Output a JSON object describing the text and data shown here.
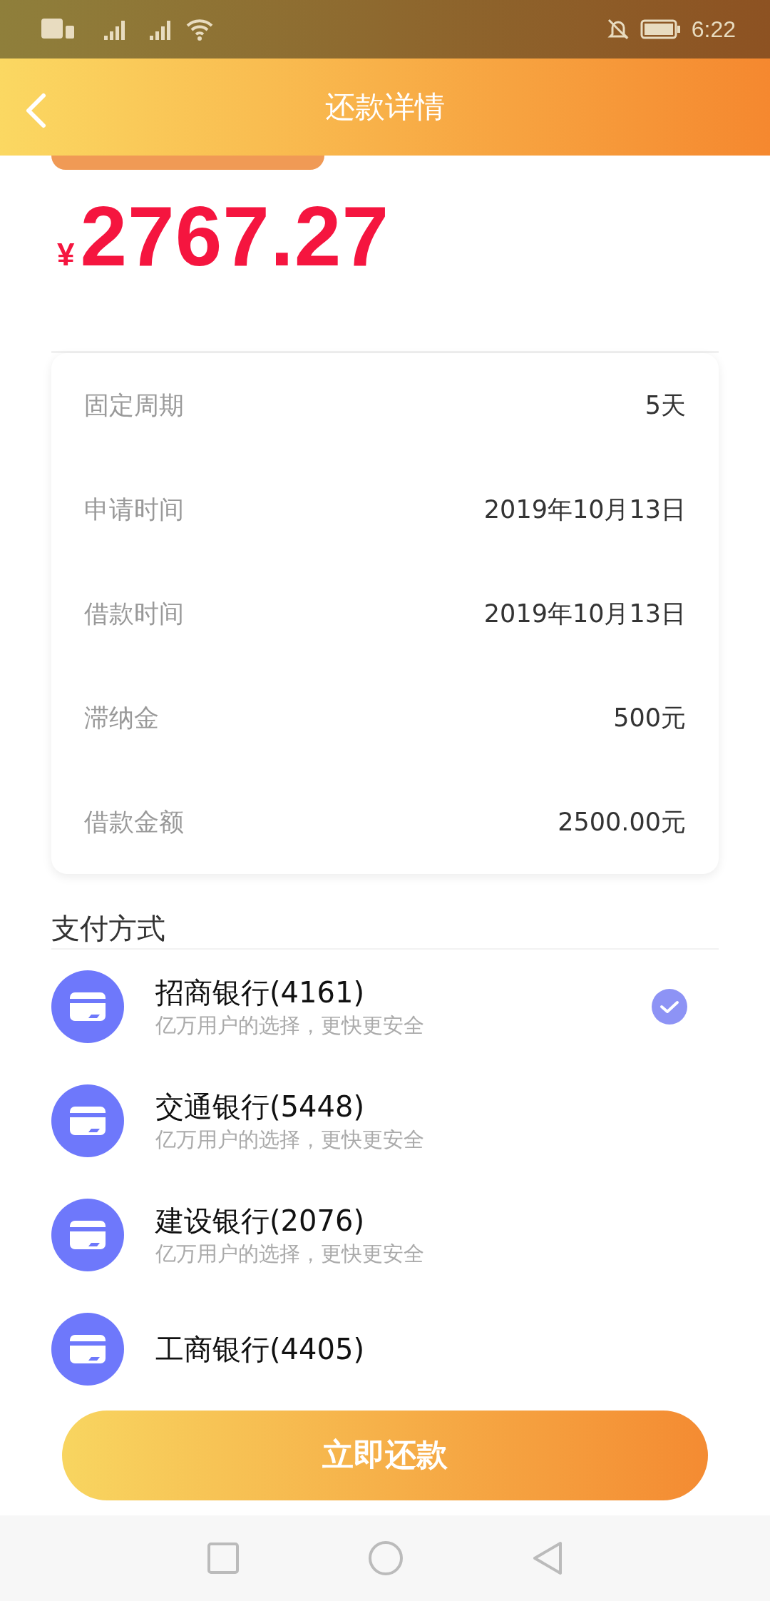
{
  "status_bar": {
    "time": "6:22"
  },
  "header": {
    "title": "还款详情"
  },
  "amount": {
    "currency": "¥",
    "value": "2767.27"
  },
  "details": [
    {
      "label": "固定周期",
      "value": "5天"
    },
    {
      "label": "申请时间",
      "value": "2019年10月13日"
    },
    {
      "label": "借款时间",
      "value": "2019年10月13日"
    },
    {
      "label": "滞纳金",
      "value": "500元"
    },
    {
      "label": "借款金额",
      "value": "2500.00元"
    }
  ],
  "payment": {
    "title": "支付方式",
    "methods": [
      {
        "name": "招商银行(4161)",
        "note": "亿万用户的选择，更快更安全",
        "selected": true
      },
      {
        "name": "交通银行(5448)",
        "note": "亿万用户的选择，更快更安全",
        "selected": false
      },
      {
        "name": "建设银行(2076)",
        "note": "亿万用户的选择，更快更安全",
        "selected": false
      },
      {
        "name": "工商银行(4405)",
        "selected": false
      }
    ]
  },
  "action": {
    "label": "立即还款"
  }
}
